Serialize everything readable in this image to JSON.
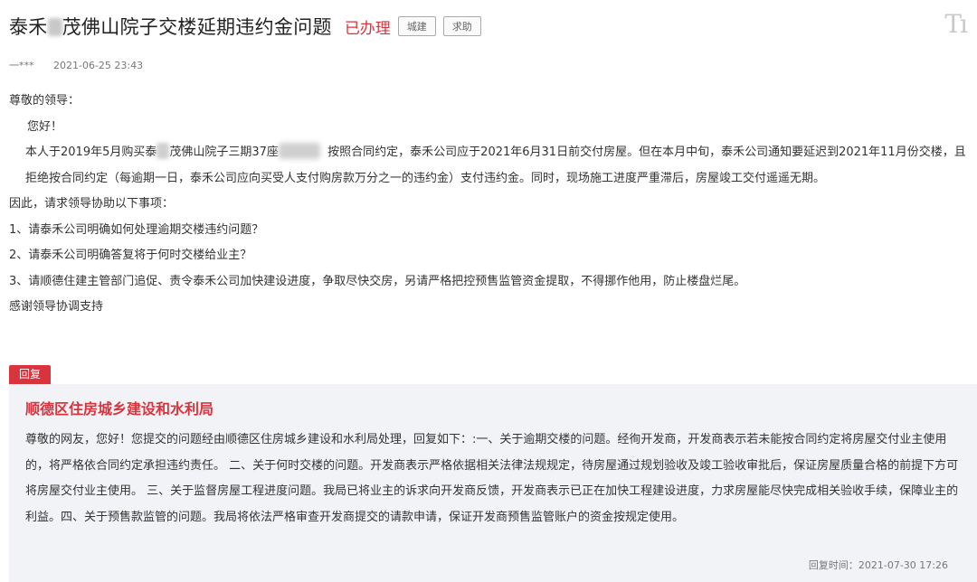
{
  "header": {
    "title_prefix": "泰禾",
    "title_suffix": "茂佛山院子交楼延期违约金问题",
    "status": "已办理",
    "tags": [
      "城建",
      "求助"
    ],
    "font_tool_glyph": "Tı"
  },
  "meta": {
    "user": "一***",
    "date": "2021-06-25 23:43"
  },
  "letter": {
    "salutation": "尊敬的领导：",
    "greeting": "您好！",
    "body_part1": "本人于2019年5月购买泰",
    "body_part2": "茂佛山院子三期37座",
    "body_part3": "按照合同约定，泰禾公司应于2021年6月31日前交付房屋。但在本月中旬，泰禾公司通知要延迟到2021年11月份交楼，且拒绝按合同约定（每逾期一日，泰禾公司应向买受人支付购房款万分之一的违约金）支付违约金。同时，现场施工进度严重滞后，房屋竣工交付遥遥无期。",
    "request_intro": "因此，请求领导协助以下事项：",
    "requests": [
      "1、请泰禾公司明确如何处理逾期交楼违约问题？",
      "2、请泰禾公司明确答复将于何时交楼给业主？",
      "3、请顺德住建主管部门追促、责令泰禾公司加快建设进度，争取尽快交房，另请严格把控预售监管资金提取，不得挪作他用，防止楼盘烂尾。"
    ],
    "closing": "感谢领导协调支持"
  },
  "reply": {
    "label": "回复",
    "department": "顺德区住房城乡建设和水利局",
    "text": "尊敬的网友，您好！您提交的问题经由顺德区住房城乡建设和水利局处理，回复如下：:一、关于逾期交楼的问题。经徇开发商，开发商表示若未能按合同约定将房屋交付业主使用的，将严格依合同约定承担违约责任。 二、关于何时交楼的问题。开发商表示严格依据相关法律法规规定，待房屋通过规划验收及竣工验收审批后，保证房屋质量合格的前提下方可将房屋交付业主使用。 三、关于监督房屋工程进度问题。我局已将业主的诉求向开发商反馈，开发商表示已正在加快工程建设进度，力求房屋能尽快完成相关验收手续，保障业主的利益。四、关于预售款监管的问题。我局将依法严格审查开发商提交的请款申请，保证开发商预售监管账户的资金按规定使用。",
    "time_label": "回复时间：",
    "time": "2021-07-30 17:26"
  },
  "colors": {
    "accent": "#d9343e",
    "reply_bg": "#f2f3f7"
  }
}
